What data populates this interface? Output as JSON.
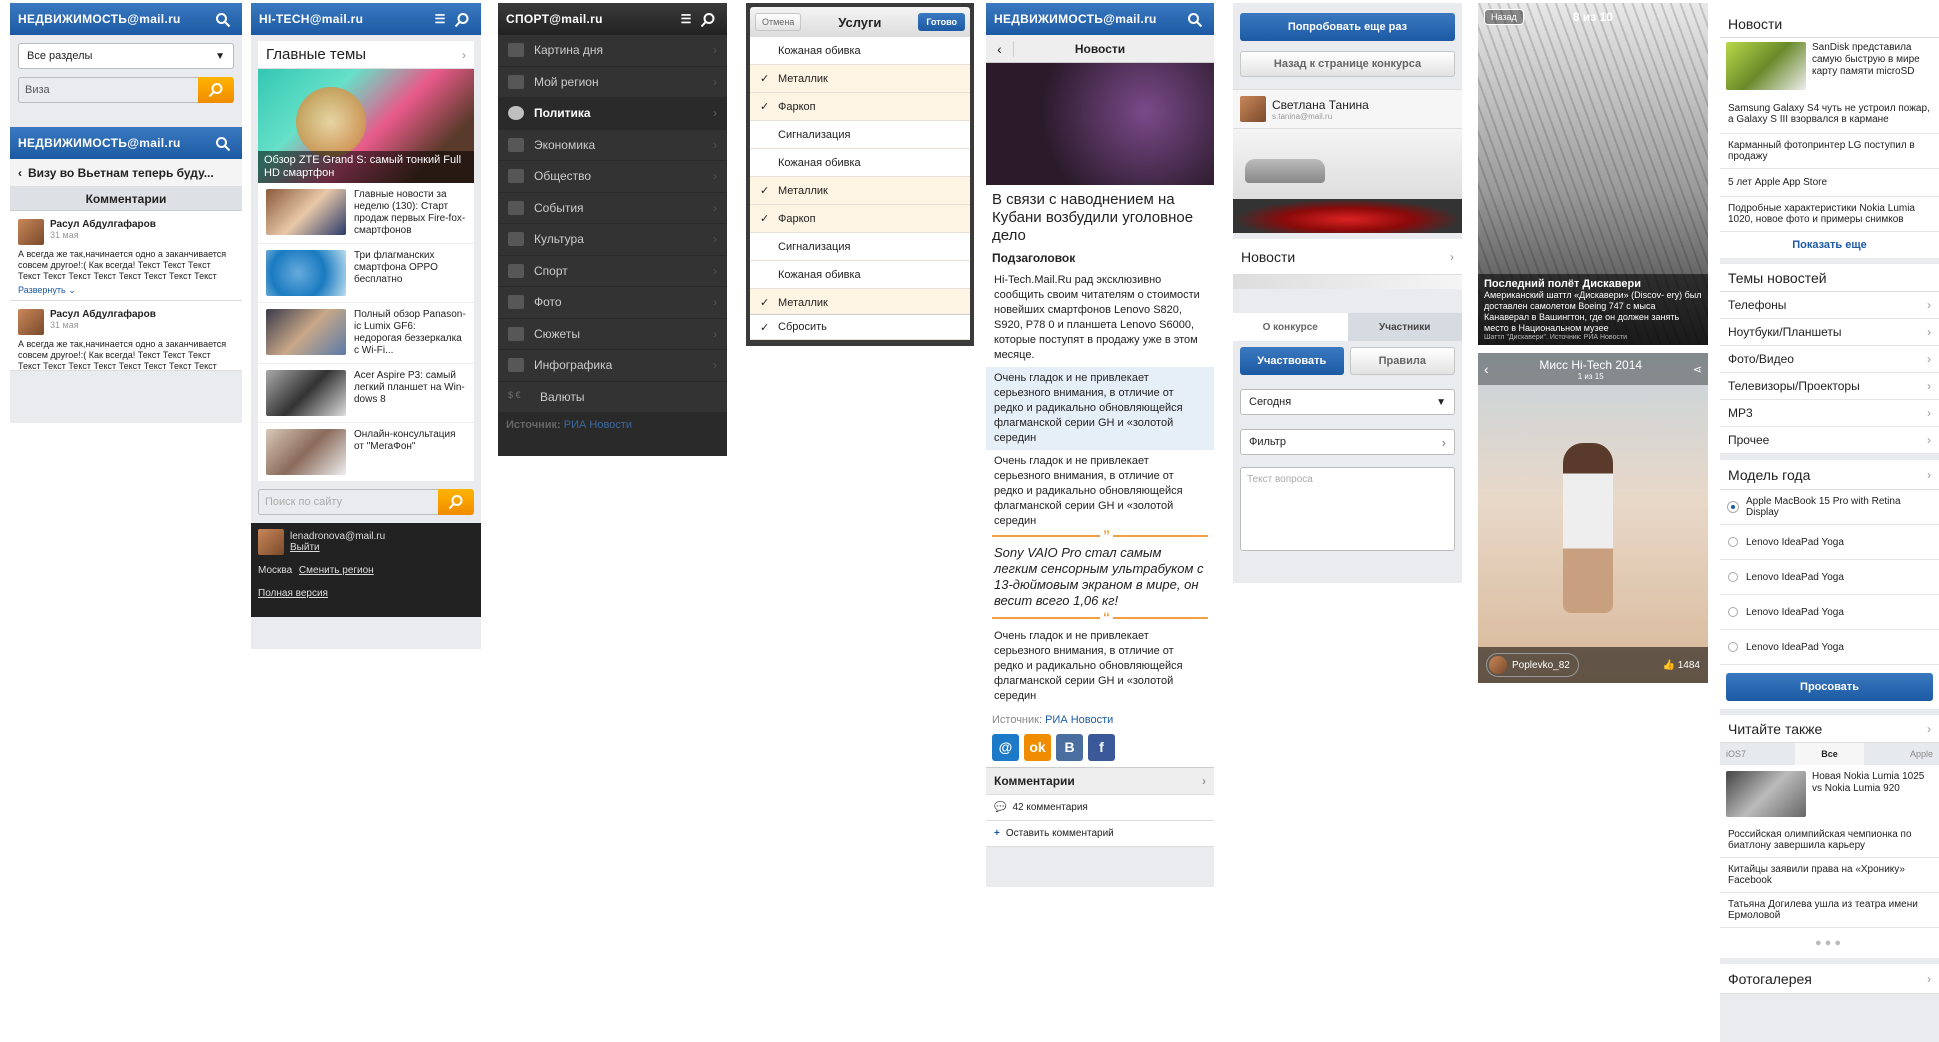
{
  "brands": {
    "realty": "НЕДВИЖИМОСТЬ@mail.ru",
    "hitech": "HI-TECH@mail.ru",
    "sport": "СПОРТ@mail.ru"
  },
  "screen1": {
    "section_select": "Все разделы",
    "search_value": "Виза",
    "article_title": "Визу во Вьетнам теперь буду...",
    "comments_header": "Комментарии",
    "comments": [
      {
        "name": "Расул Абдулгафаров",
        "date": "31 мая",
        "text": "А всегда же так,начинается одно а заканчивается совсем другое!:( Как всегда! Текст Текст Текст Текст Текст Текст Текст Текст Текст Текст Текст",
        "more": "Развернуть"
      },
      {
        "name": "Расул Абдулгафаров",
        "date": "31 мая",
        "text": "А всегда же так,начинается одно а заканчивается совсем другое!:( Как всегда! Текст Текст Текст Текст Текст Текст Текст Текст Текст Текст Текст Текст Текст Текст Текст"
      }
    ]
  },
  "screen2": {
    "section_title": "Главные темы",
    "hero_caption": "Обзор ZTE Grand S: самый тонкий Full HD смартфон",
    "news": [
      "Главные новости за неделю (130): Старт продаж первых Fire-fox-смартфонов",
      "Три флагманских смартфона OPPO бесплатно",
      "Полный обзор Panason- ic Lumix GF6: недорогая беззеркалка с Wi-Fi...",
      "Acer Aspire P3: самый легкий планшет на Win- dows 8",
      "Онлайн-консультация от \"МегаФон\""
    ],
    "search_placeholder": "Поиск по сайту",
    "user_email": "lenadronova@mail.ru",
    "logout": "Выйти",
    "city": "Москва",
    "change_region": "Сменить регион",
    "full_version": "Полная версия"
  },
  "screen3": {
    "menu": [
      "Картина дня",
      "Мой регион",
      "Политика",
      "Экономика",
      "Общество",
      "События",
      "Культура",
      "Спорт",
      "Фото",
      "Сюжеты",
      "Инфографика",
      "Валюты"
    ],
    "active_index": 2,
    "source_label": "Источник:",
    "source_name": "РИА Новости"
  },
  "screen4": {
    "cancel": "Отмена",
    "title": "Услуги",
    "done": "Готово",
    "options": [
      {
        "label": "Кожаная обивка",
        "checked": false
      },
      {
        "label": "Металлик",
        "checked": true
      },
      {
        "label": "Фаркоп",
        "checked": true
      },
      {
        "label": "Сигнализация",
        "checked": false
      },
      {
        "label": "Кожаная обивка",
        "checked": false
      },
      {
        "label": "Металлик",
        "checked": true
      },
      {
        "label": "Фаркоп",
        "checked": true
      },
      {
        "label": "Сигнализация",
        "checked": false
      },
      {
        "label": "Кожаная обивка",
        "checked": false
      },
      {
        "label": "Металлик",
        "checked": true
      }
    ],
    "reset": "Сбросить"
  },
  "screen5": {
    "nav_title": "Новости",
    "headline": "В связи с наводнением на Кубани возбудили уголовное дело",
    "subheading": "Подзаголовок",
    "lead": "Hi-Tech.Mail.Ru рад эксклюзивно сообщить своим читателям о стоимости новейших смартфонов Lenovo S820, S920, P78 0 и планшета Lenovo S6000, которые поступят в продажу уже в этом месяце.",
    "para": "Очень гладок и не привлекает серьезного внимания, в отличие от редко и радикально обновляющейся флагманской серии GH и «золотой середин",
    "quote": "Sony VAIO Pro стал самым легким сенсорным ультрабуком с 13-дюймовым экраном в мире, он весит всего 1,06 кг!",
    "source_label": "Источник:",
    "source_name": "РИА Новости",
    "comments_header": "Комментарии",
    "comments_count": "42 комментария",
    "leave_comment": "Оставить комментарий"
  },
  "screen6": {
    "retry": "Попробовать еще раз",
    "back_contest": "Назад к странице конкурса",
    "user_name": "Светлана Танина",
    "user_email": "s.tanina@mail.ru",
    "news_header": "Новости",
    "tab_about": "О конкурсе",
    "tab_participants": "Участники",
    "participate": "Участвовать",
    "rules": "Правила",
    "date_select": "Сегодня",
    "filter": "Фильтр",
    "question_placeholder": "Текст вопроса"
  },
  "screen7": {
    "back": "Назад",
    "counter": "8 из 10",
    "caption_title": "Последний полёт Дискавери",
    "caption_text": "Американский шаттл «Дискавери» (Discov- ery) был доставлен самолетом Boeing 747 с мыса Канаверал в Вашингтон, где он должен занять место в Национальном музее",
    "caption_source": "Шаттл \"Дискавери\". Источник: РИА Новости",
    "gallery_title": "Мисс Hi-Tech 2014",
    "gallery_counter": "1 из 15",
    "user": "Poplevko_82",
    "likes": "1484"
  },
  "screen8": {
    "news_header": "Новости",
    "top_item": "SanDisk представила самую быструю в мире карту памяти microSD",
    "news": [
      "Samsung Galaxy S4 чуть не устроил пожар, а Galaxy S III взорвался в кармане",
      "Карманный фотопринтер LG поступил в продажу",
      "5 лет Apple App Store",
      "Подробные характеристики Nokia Lumia 1020, новое фото и примеры снимков"
    ],
    "show_more": "Показать еще",
    "topics_header": "Темы новостей",
    "topics": [
      "Телефоны",
      "Ноутбуки/Планшеты",
      "Фото/Видео",
      "Телевизоры/Проекторы",
      "MP3",
      "Прочее"
    ],
    "model_header": "Модель года",
    "models": [
      "Apple MacBook 15 Pro with Retina Display",
      "Lenovo IdeaPad Yoga",
      "Lenovo IdeaPad Yoga",
      "Lenovo IdeaPad Yoga",
      "Lenovo IdeaPad Yoga"
    ],
    "vote": "Просовать",
    "read_also": "Читайте также",
    "seg": [
      "iOS7",
      "Все",
      "Apple"
    ],
    "also_top": "Новая Nokia Lumia 1025 vs Nokia Lumia 920",
    "also": [
      "Российская олимпийская чемпионка по биатлону завершила карьеру",
      "Китайцы заявили права на «Хронику» Facebook",
      "Татьяна Догилева ушла из театра имени Ермоловой"
    ],
    "gallery": "Фотогалерея"
  }
}
